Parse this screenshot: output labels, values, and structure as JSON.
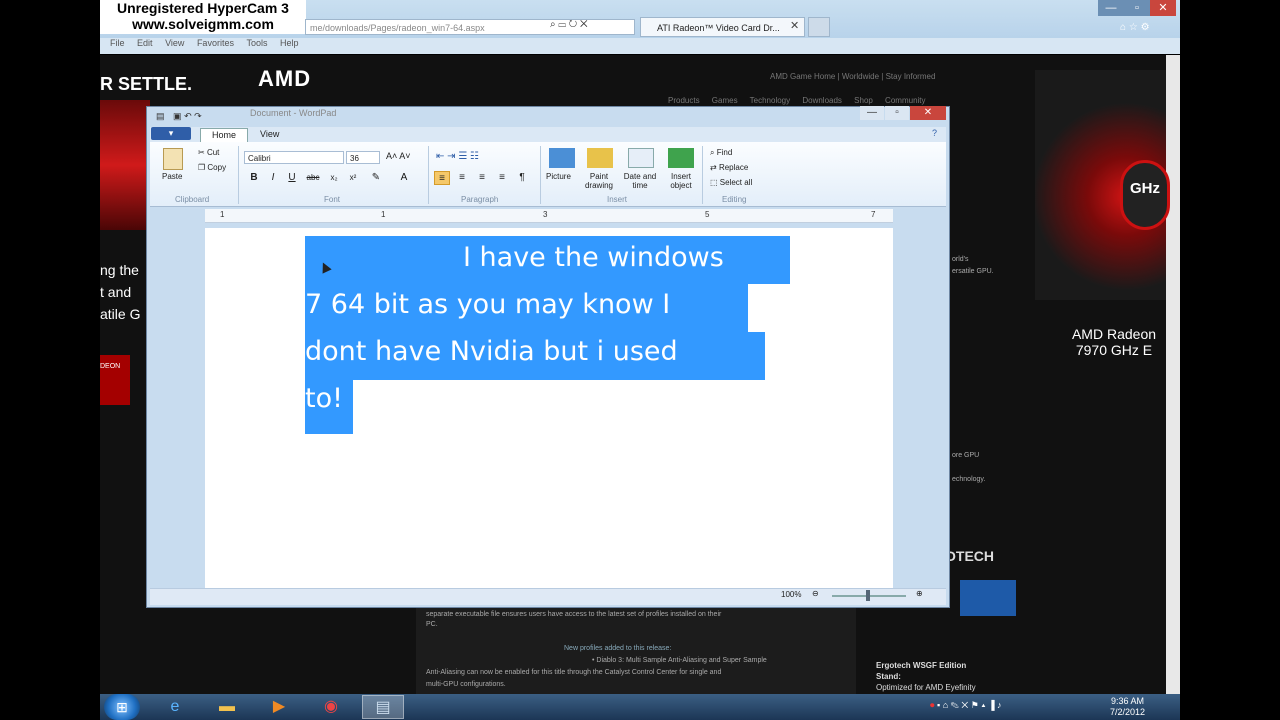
{
  "watermark": {
    "line1": "Unregistered HyperCam 3",
    "line2": "www.solveigmm.com"
  },
  "browser": {
    "address": "me/downloads/Pages/radeon_win7-64.aspx",
    "tab_title": "ATI Radeon™ Video Card Dr...",
    "menu": [
      "File",
      "Edit",
      "View",
      "Favorites",
      "Tools",
      "Help"
    ]
  },
  "webpage": {
    "banner_text": "R SETTLE.",
    "logo": "AMD",
    "nav_top": "AMD Game Home  |  Worldwide  |  Stay Informed",
    "nav_main": "Products Games Technology Downloads Shop Community",
    "side_lines": [
      "ng the",
      "t and",
      "atile G"
    ],
    "badge": "DEON",
    "product_name": "AMD Radeon 7970 GHz E",
    "ghz_badge": "GHz",
    "right_snips": [
      "orld's",
      "ersatile GPU.",
      "ore GPU",
      "echnology.",
      "OTECH"
    ],
    "panel_lines": [
      "separate executable file ensures users have access to the latest set of profiles installed on their",
      "PC.",
      "New profiles added to this release:",
      "• Diablo 3: Multi Sample Anti-Aliasing and Super Sample",
      "Anti-Aliasing can now be enabled for this title through the Catalyst Control Center for single and",
      "multi-GPU configurations."
    ],
    "ergo_title": "Ergotech WSGF Edition",
    "ergo_stand": "Stand:",
    "ergo_sub": "Optimized for AMD Eyefinity"
  },
  "wordpad": {
    "title": "Document - WordPad",
    "menu_button": "▾",
    "tabs": [
      "Home",
      "View"
    ],
    "clipboard": {
      "paste": "Paste",
      "cut": "Cut",
      "copy": "Copy",
      "label": "Clipboard"
    },
    "font": {
      "name": "Calibri",
      "size": "36",
      "label": "Font"
    },
    "paragraph_label": "Paragraph",
    "insert": {
      "picture": "Picture",
      "paint": "Paint drawing",
      "datetime": "Date and time",
      "object": "Insert object",
      "label": "Insert"
    },
    "editing": {
      "find": "Find",
      "replace": "Replace",
      "select_all": "Select all",
      "label": "Editing"
    },
    "document_lines": [
      "I have the windows",
      "7 64 bit as you may know I",
      "dont have Nvidia but i used",
      "to!"
    ],
    "zoom": "100%"
  },
  "taskbar": {
    "time": "9:36 AM",
    "date": "7/2/2012"
  }
}
